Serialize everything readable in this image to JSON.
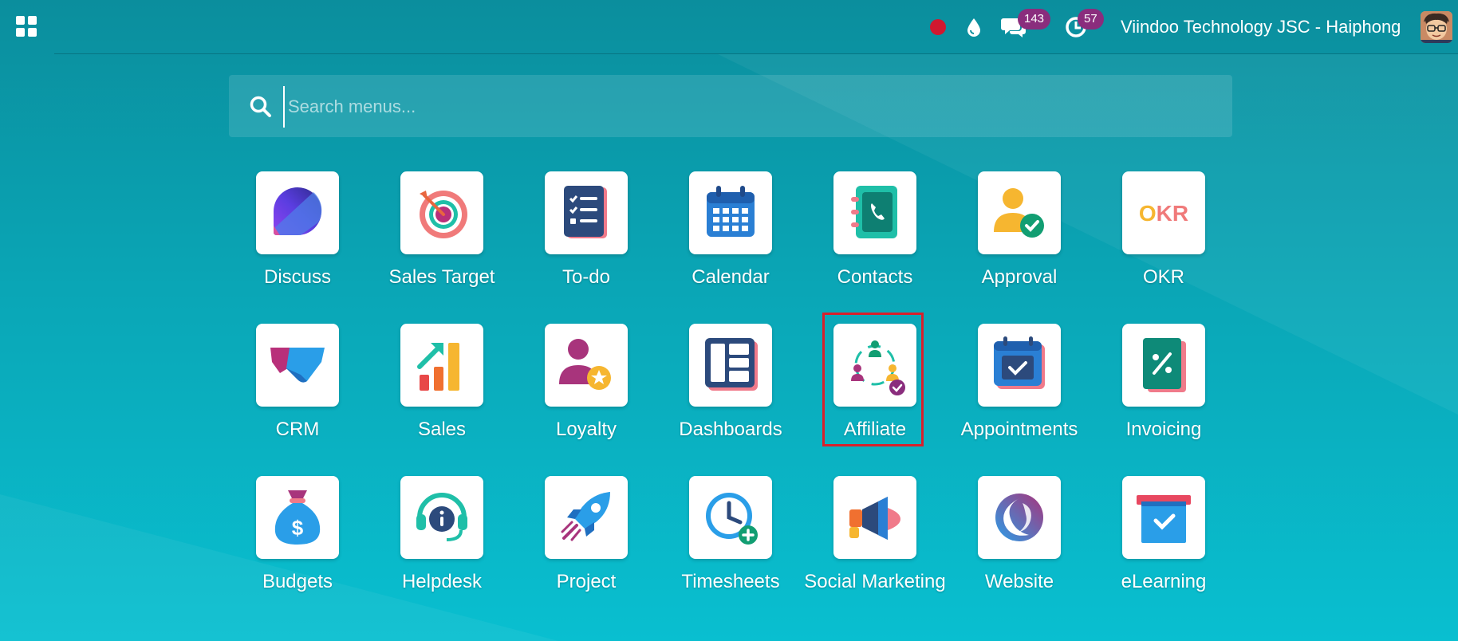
{
  "topbar": {
    "apps_menu_icon": "grid-icon",
    "record_icon": "record-dot-icon",
    "drop_icon": "drop-icon",
    "chat_icon": "chat-icon",
    "messages_count": "143",
    "activity_icon": "clock-icon",
    "activities_count": "57",
    "company": "Viindoo Technology JSC - Haiphong",
    "avatar_icon": "user-avatar"
  },
  "search": {
    "placeholder": "Search menus...",
    "value": ""
  },
  "apps": [
    {
      "label": "Discuss",
      "icon": "discuss-icon"
    },
    {
      "label": "Sales Target",
      "icon": "target-icon"
    },
    {
      "label": "To-do",
      "icon": "todo-icon"
    },
    {
      "label": "Calendar",
      "icon": "calendar-icon"
    },
    {
      "label": "Contacts",
      "icon": "contacts-icon"
    },
    {
      "label": "Approval",
      "icon": "approval-icon"
    },
    {
      "label": "OKR",
      "icon": "okr-icon"
    },
    {
      "label": "CRM",
      "icon": "crm-icon"
    },
    {
      "label": "Sales",
      "icon": "sales-icon"
    },
    {
      "label": "Loyalty",
      "icon": "loyalty-icon"
    },
    {
      "label": "Dashboards",
      "icon": "dashboards-icon"
    },
    {
      "label": "Affiliate",
      "icon": "affiliate-icon"
    },
    {
      "label": "Appointments",
      "icon": "appointments-icon"
    },
    {
      "label": "Invoicing",
      "icon": "invoicing-icon"
    },
    {
      "label": "Budgets",
      "icon": "budgets-icon"
    },
    {
      "label": "Helpdesk",
      "icon": "helpdesk-icon"
    },
    {
      "label": "Project",
      "icon": "project-icon"
    },
    {
      "label": "Timesheets",
      "icon": "timesheets-icon"
    },
    {
      "label": "Social Marketing",
      "icon": "social-marketing-icon"
    },
    {
      "label": "Website",
      "icon": "website-icon"
    },
    {
      "label": "eLearning",
      "icon": "elearning-icon"
    }
  ],
  "okr_text": "OKR",
  "colors": {
    "background_top": "#0b8e9d",
    "background_bottom": "#09bfd0",
    "badge": "#8a2d7d",
    "record_dot": "#d0182f",
    "highlight": "#d8202b"
  }
}
